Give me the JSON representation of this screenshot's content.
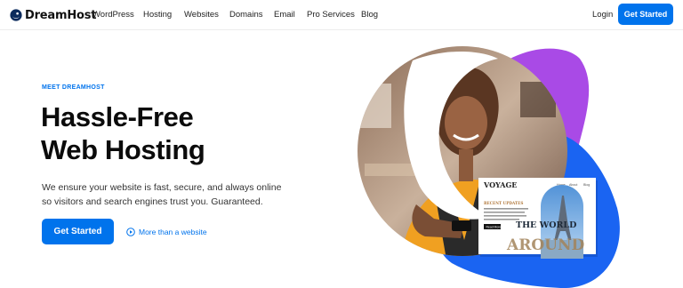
{
  "nav": {
    "logo_text": "DreamHost",
    "items": [
      {
        "label": "WordPress"
      },
      {
        "label": "Hosting"
      },
      {
        "label": "Websites"
      },
      {
        "label": "Domains"
      },
      {
        "label": "Email"
      },
      {
        "label": "Pro Services"
      },
      {
        "label": "Blog"
      }
    ],
    "login_label": "Login",
    "cta_label": "Get Started"
  },
  "hero": {
    "eyebrow": "MEET DREAMHOST",
    "title_line1": "Hassle-Free",
    "title_line2": "Web Hosting",
    "description": "We ensure your website is fast, secure, and always online so visitors and search engines trust you. Guaranteed.",
    "cta_label": "Get Started",
    "secondary_label": "More than a website",
    "secondary_icon": "play-circle-icon"
  },
  "mockup": {
    "brand": "VOYAGE",
    "nav_items": [
      "Home",
      "About",
      "Blog"
    ],
    "section_title": "RECENT UPDATES",
    "button_label": "Read More",
    "headline_line1": "THE WORLD",
    "headline_line2": "AROUND"
  },
  "colors": {
    "primary": "#0073ec",
    "purple": "#a94ae6",
    "blue_blob": "#1a64f2"
  }
}
